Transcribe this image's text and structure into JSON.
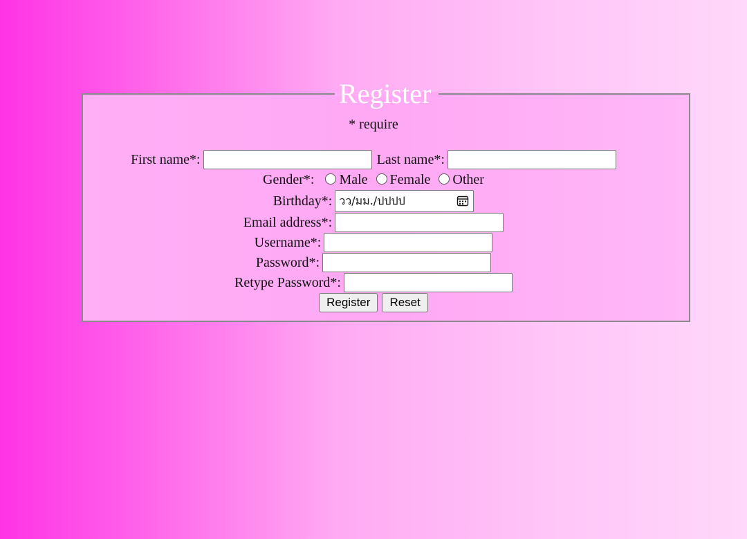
{
  "form": {
    "legend": "Register",
    "require_note": "* require",
    "first_name_label": "First name*:",
    "first_name_value": "",
    "last_name_label": "Last name*:",
    "last_name_value": "",
    "gender_label": "Gender*:",
    "gender_options": [
      "Male",
      "Female",
      "Other"
    ],
    "birthday_label": "Birthday*:",
    "birthday_placeholder": "วว/มม./ปปปป",
    "email_label": "Email address*:",
    "email_value": "",
    "username_label": "Username*:",
    "username_value": "",
    "password_label": "Password*:",
    "password_value": "",
    "retype_label": "Retype Password*:",
    "retype_value": "",
    "register_button": "Register",
    "reset_button": "Reset"
  },
  "icons": {
    "birthday_picker": "calendar-icon"
  }
}
